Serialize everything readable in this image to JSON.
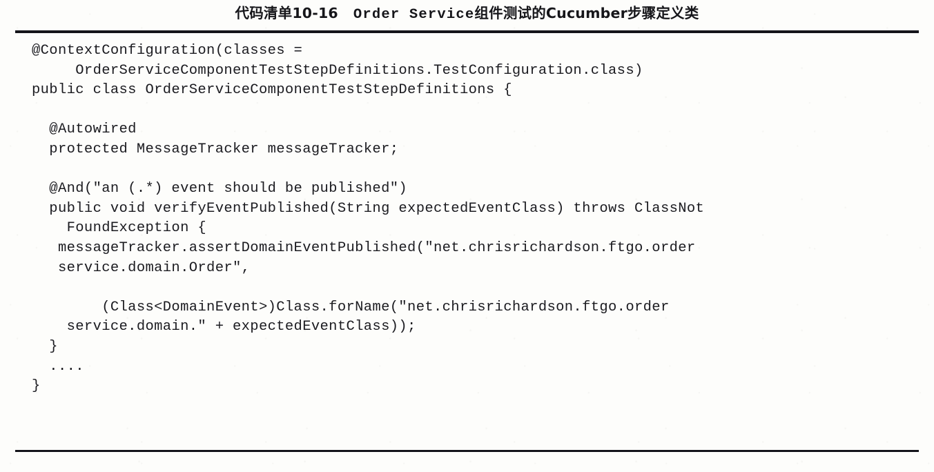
{
  "caption": {
    "listing_label": "代码清单10-16",
    "code_title": "Order Service",
    "title_tail": "组件测试的Cucumber步骤定义类",
    "full_text": "代码清单10-16　Order Service组件测试的Cucumber步骤定义类"
  },
  "code": {
    "language": "java",
    "lines": [
      "@ContextConfiguration(classes =",
      "     OrderServiceComponentTestStepDefinitions.TestConfiguration.class)",
      "public class OrderServiceComponentTestStepDefinitions {",
      "",
      "  @Autowired",
      "  protected MessageTracker messageTracker;",
      "",
      "  @And(\"an (.*) event should be published\")",
      "  public void verifyEventPublished(String expectedEventClass) throws ClassNot",
      "    FoundException {",
      "   messageTracker.assertDomainEventPublished(\"net.chrisrichardson.ftgo.order",
      "   service.domain.Order\",",
      "",
      "        (Class<DomainEvent>)Class.forName(\"net.chrisrichardson.ftgo.order",
      "    service.domain.\" + expectedEventClass));",
      "  }",
      "  ....",
      "}"
    ]
  },
  "colors": {
    "page_background": "#fdfdfb",
    "text": "#1b1b20",
    "rule": "#14141a",
    "caption_text": "#16161a"
  }
}
